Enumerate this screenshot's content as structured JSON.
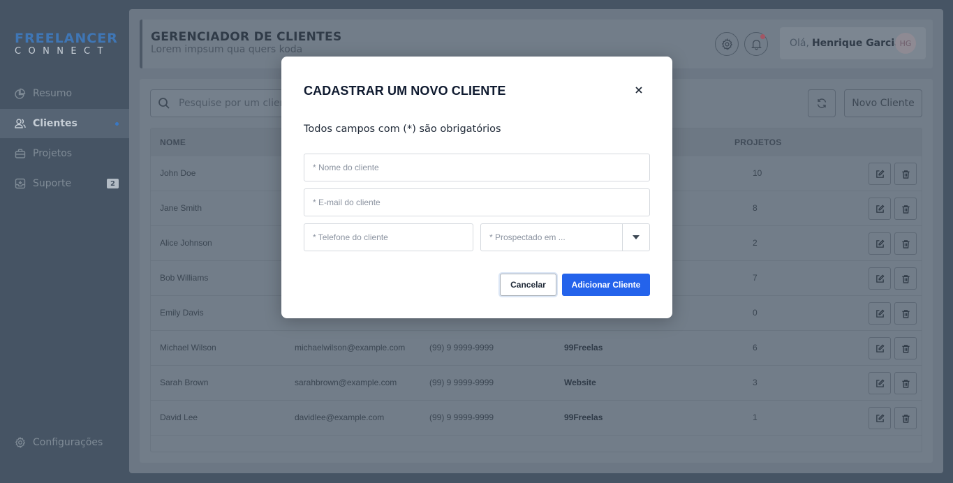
{
  "brand": {
    "line1": "FREELANCER",
    "line2": "CONNECT"
  },
  "sidebar": {
    "items": [
      {
        "label": "Resumo",
        "icon": "pie-chart-icon"
      },
      {
        "label": "Clientes",
        "icon": "users-icon",
        "active": true
      },
      {
        "label": "Projetos",
        "icon": "briefcase-icon"
      },
      {
        "label": "Suporte",
        "icon": "inbox-icon",
        "badge": "2"
      }
    ],
    "settings_label": "Configurações"
  },
  "header": {
    "title": "GERENCIADOR DE CLIENTES",
    "subtitle": "Lorem impsum qua quers koda",
    "greeting": "Olá,",
    "user_name": "Henrique Garcia",
    "avatar_initials": "HG"
  },
  "toolbar": {
    "search_placeholder": "Pesquise por um cliente",
    "new_client_label": "Novo Cliente"
  },
  "table": {
    "headers": {
      "name": "NOME",
      "projects": "PROJETOS"
    },
    "rows": [
      {
        "name": "John Doe",
        "email": "",
        "phone": "",
        "source": "",
        "projects": "10"
      },
      {
        "name": "Jane Smith",
        "email": "",
        "phone": "",
        "source": "",
        "projects": "8"
      },
      {
        "name": "Alice Johnson",
        "email": "",
        "phone": "",
        "source": "",
        "projects": "2"
      },
      {
        "name": "Bob Williams",
        "email": "",
        "phone": "",
        "source": "",
        "projects": "7"
      },
      {
        "name": "Emily Davis",
        "email": "",
        "phone": "",
        "source": "",
        "projects": "0"
      },
      {
        "name": "Michael Wilson",
        "email": "michaelwilson@example.com",
        "phone": "(99) 9 9999-9999",
        "source": "99Freelas",
        "projects": "6"
      },
      {
        "name": "Sarah Brown",
        "email": "sarahbrown@example.com",
        "phone": "(99) 9 9999-9999",
        "source": "Website",
        "projects": "3"
      },
      {
        "name": "David Lee",
        "email": "davidlee@example.com",
        "phone": "(99) 9 9999-9999",
        "source": "99Freelas",
        "projects": "1"
      }
    ]
  },
  "modal": {
    "title": "CADASTRAR UM NOVO CLIENTE",
    "note": "Todos campos com (*) são obrigatórios",
    "name_placeholder": "* Nome do cliente",
    "email_placeholder": "* E-mail do cliente",
    "phone_placeholder": "* Telefone do cliente",
    "prospected_placeholder": "* Prospectado em ...",
    "cancel_label": "Cancelar",
    "submit_label": "Adicionar Cliente"
  },
  "colors": {
    "accent": "#2463eb",
    "brand": "#3f76b5"
  }
}
